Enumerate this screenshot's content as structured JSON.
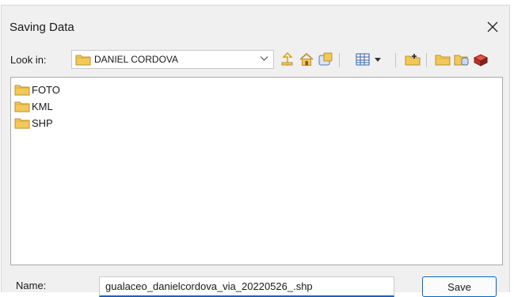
{
  "window": {
    "title": "Saving Data",
    "close_icon": "close-icon"
  },
  "lookin": {
    "label": "Look in:",
    "current_folder": "DANIEL CORDOVA"
  },
  "toolbar": {
    "icons": [
      "up-one-level-icon",
      "home-icon",
      "database-connection-icon",
      "view-menu-icon",
      "connect-to-folder-icon",
      "new-folder-icon",
      "new-file-geodatabase-icon",
      "new-toolbox-icon"
    ]
  },
  "files": [
    {
      "name": "FOTO",
      "icon": "folder-icon"
    },
    {
      "name": "KML",
      "icon": "folder-icon"
    },
    {
      "name": "SHP",
      "icon": "folder-icon"
    }
  ],
  "footer": {
    "name_label": "Name:",
    "name_value": "gualaceo_danielcordova_via_20220526_.shp",
    "save_label": "Save"
  },
  "colors": {
    "accent": "#0067c0",
    "folder": "#f3c85a"
  }
}
